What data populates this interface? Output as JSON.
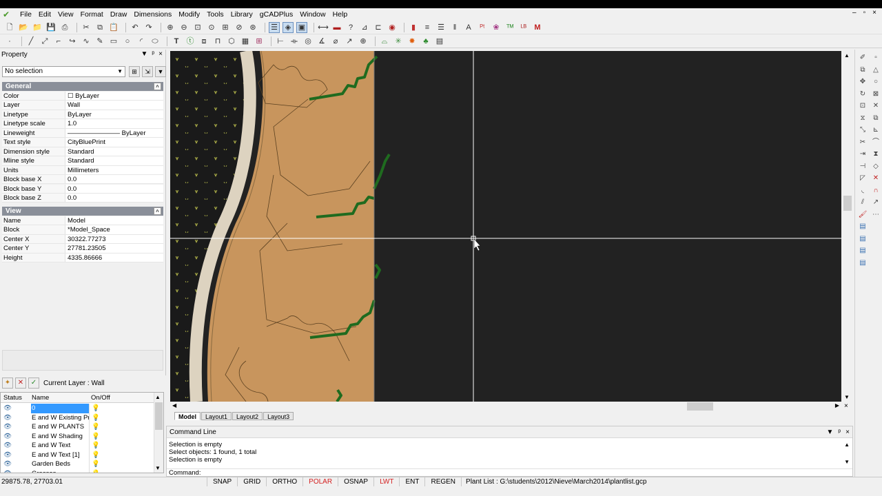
{
  "menu": [
    "File",
    "Edit",
    "View",
    "Format",
    "Draw",
    "Dimensions",
    "Modify",
    "Tools",
    "Library",
    "gCADPlus",
    "Window",
    "Help"
  ],
  "window_buttons": [
    "–",
    "▫",
    "×"
  ],
  "property_panel": {
    "title": "Property",
    "title_buttons": [
      "▼",
      "ᵖ",
      "×"
    ],
    "selection": "No selection",
    "general_header": "General",
    "general": [
      {
        "key": "Color",
        "value": "☐ ByLayer"
      },
      {
        "key": "Layer",
        "value": "Wall"
      },
      {
        "key": "Linetype",
        "value": "ByLayer"
      },
      {
        "key": "Linetype scale",
        "value": "1.0"
      },
      {
        "key": "Lineweight",
        "value": "————————  ByLayer"
      },
      {
        "key": "Text style",
        "value": "CityBluePrint"
      },
      {
        "key": "Dimension style",
        "value": "Standard"
      },
      {
        "key": "Mline style",
        "value": "Standard"
      },
      {
        "key": "Units",
        "value": "Millimeters"
      },
      {
        "key": "Block base X",
        "value": "0.0"
      },
      {
        "key": "Block base Y",
        "value": "0.0"
      },
      {
        "key": "Block base Z",
        "value": "0.0"
      }
    ],
    "view_header": "View",
    "view": [
      {
        "key": "Name",
        "value": "Model"
      },
      {
        "key": "Block",
        "value": "*Model_Space"
      },
      {
        "key": "Center X",
        "value": "30322.77273"
      },
      {
        "key": "Center Y",
        "value": "27781.23505"
      },
      {
        "key": "Height",
        "value": "4335.86666"
      }
    ]
  },
  "layer_panel": {
    "current_layer": "Current Layer : Wall",
    "columns": [
      "Status",
      "Name",
      "On/Off"
    ],
    "rows": [
      {
        "name": "0",
        "selected": true
      },
      {
        "name": "E and W Existing Prop",
        "selected": false
      },
      {
        "name": "E and W PLANTS",
        "selected": false
      },
      {
        "name": "E and W Shading",
        "selected": false
      },
      {
        "name": "E and W Text",
        "selected": false
      },
      {
        "name": "E and W Text [1]",
        "selected": false
      },
      {
        "name": "Garden Beds",
        "selected": false
      },
      {
        "name": "Grasses",
        "selected": false
      }
    ]
  },
  "drawing": {
    "tabs": [
      "Model",
      "Layout1",
      "Layout2",
      "Layout3"
    ],
    "active_tab": "Model",
    "colors": {
      "background": "#222222",
      "bed": "#c8955d",
      "path": "#ddd3c0",
      "lawn": "#1a1a1a",
      "hedge": "#1f6b1f",
      "crosshair": "#ffffff"
    }
  },
  "command_line": {
    "title": "Command Line",
    "history": [
      "Selection is empty",
      "Select objects: 1 found,  1 total",
      "Selection is empty"
    ],
    "prompt": "Command:"
  },
  "status_bar": {
    "coords": "29875.78, 27703.01",
    "toggles": [
      {
        "label": "SNAP",
        "on": false
      },
      {
        "label": "GRID",
        "on": false
      },
      {
        "label": "ORTHO",
        "on": false
      },
      {
        "label": "POLAR",
        "on": true
      },
      {
        "label": "OSNAP",
        "on": false
      },
      {
        "label": "LWT",
        "on": true
      },
      {
        "label": "ENT",
        "on": false
      },
      {
        "label": "REGEN",
        "on": false
      }
    ],
    "file": "Plant List : G:\\students\\2012\\Nieve\\March2014\\plantlist.gcp"
  }
}
